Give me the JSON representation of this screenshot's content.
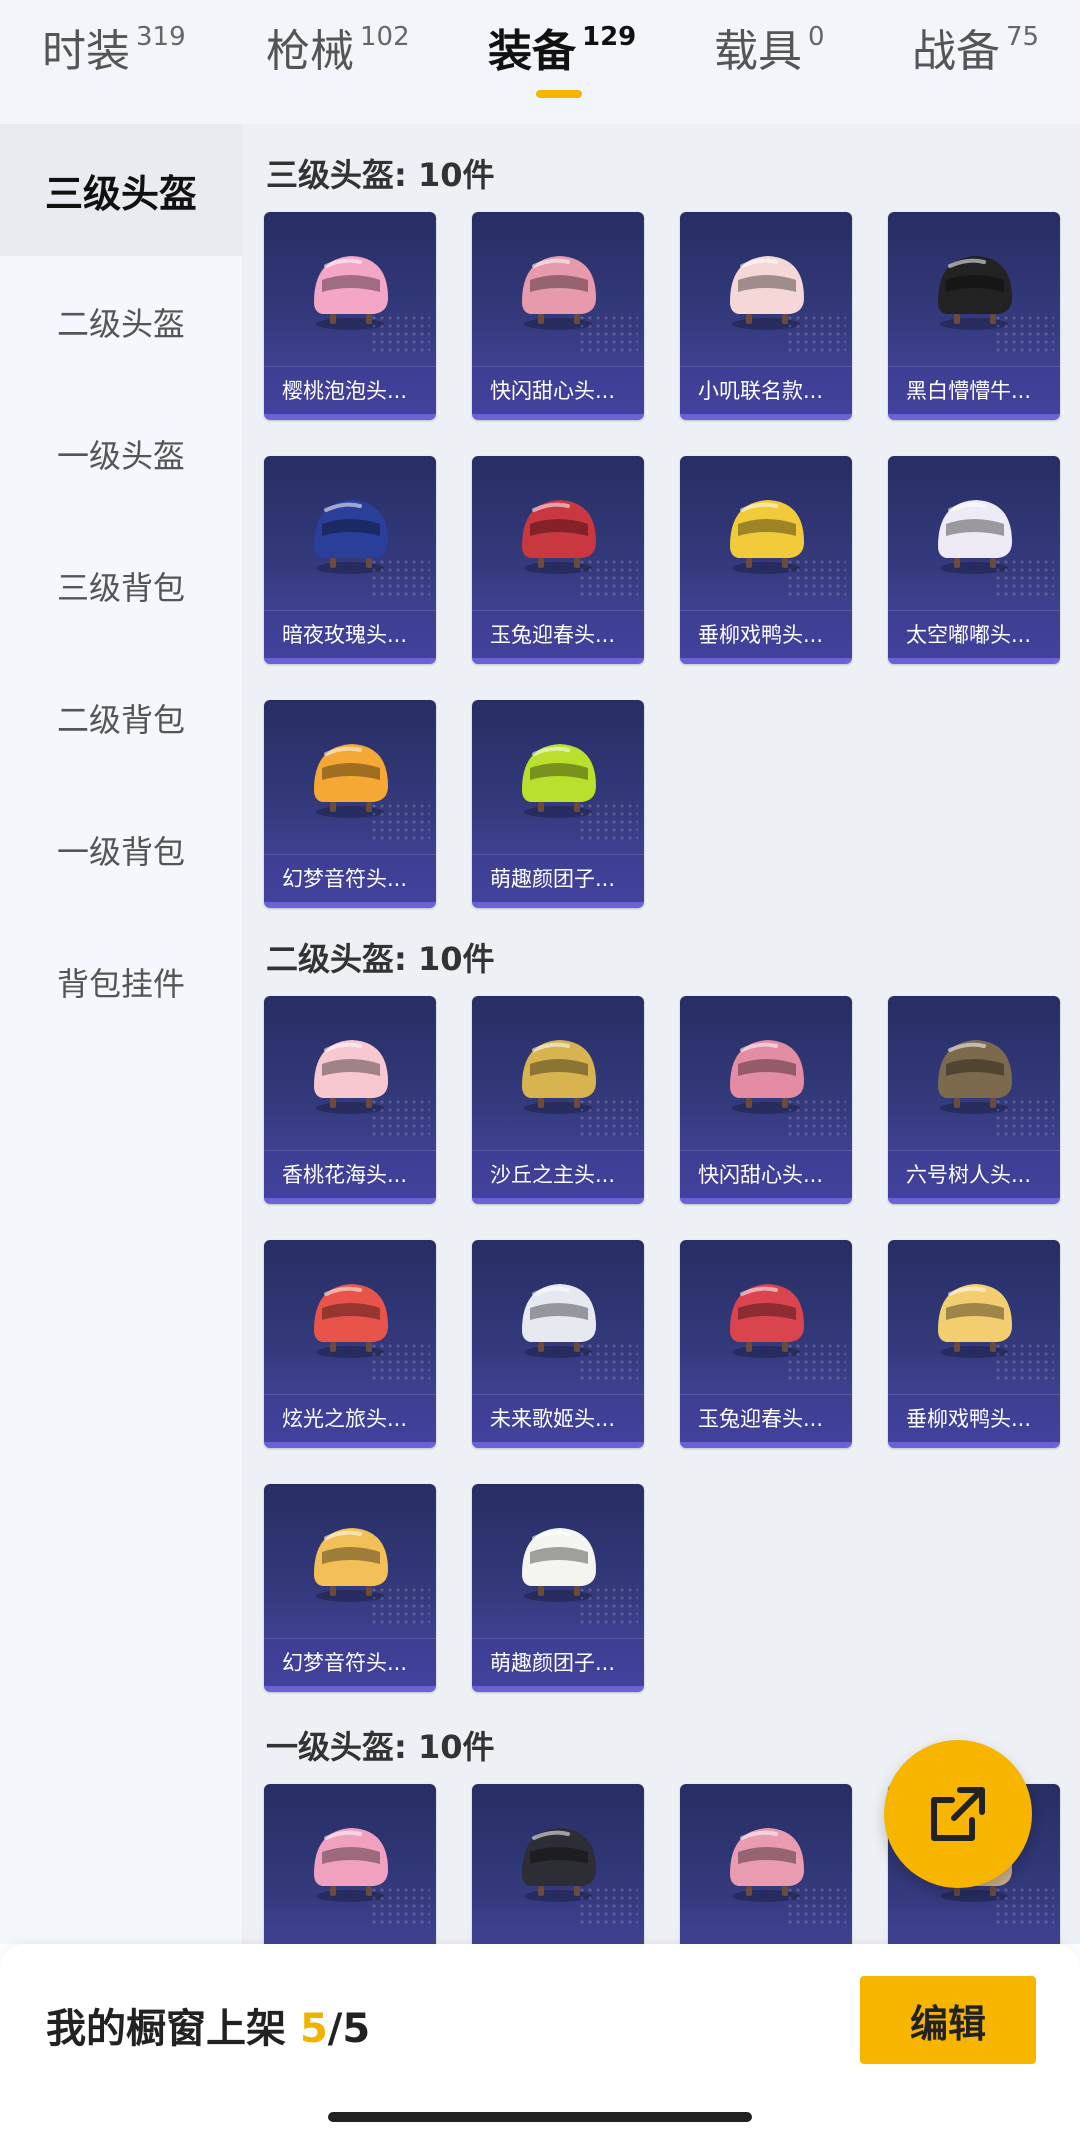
{
  "tabs": [
    {
      "label": "时装",
      "count": "319",
      "active": false
    },
    {
      "label": "枪械",
      "count": "102",
      "active": false
    },
    {
      "label": "装备",
      "count": "129",
      "active": true
    },
    {
      "label": "载具",
      "count": "0",
      "active": false
    },
    {
      "label": "战备",
      "count": "75",
      "active": false
    }
  ],
  "sidebar": {
    "items": [
      {
        "label": "三级头盔",
        "active": true
      },
      {
        "label": "二级头盔",
        "active": false
      },
      {
        "label": "一级头盔",
        "active": false
      },
      {
        "label": "三级背包",
        "active": false
      },
      {
        "label": "二级背包",
        "active": false
      },
      {
        "label": "一级背包",
        "active": false
      },
      {
        "label": "背包挂件",
        "active": false
      }
    ]
  },
  "sections": [
    {
      "title": "三级头盔: 10件",
      "items": [
        {
          "name": "樱桃泡泡头...",
          "icon": "pink-bunny-helmet",
          "color": "#f4a6c6"
        },
        {
          "name": "快闪甜心头...",
          "icon": "pink-visor-helmet",
          "color": "#e79aac"
        },
        {
          "name": "小叽联名款...",
          "icon": "white-chick-helmet",
          "color": "#f6d7d7"
        },
        {
          "name": "黑白懵懵牛...",
          "icon": "cow-helmet",
          "color": "#222222"
        },
        {
          "name": "暗夜玫瑰头...",
          "icon": "dark-rose-helmet",
          "color": "#2a3f9a"
        },
        {
          "name": "玉兔迎春头...",
          "icon": "rabbit-red-helmet",
          "color": "#c9373f"
        },
        {
          "name": "垂柳戏鸭头...",
          "icon": "duck-helmet",
          "color": "#f2cb3b"
        },
        {
          "name": "太空嘟嘟头...",
          "icon": "space-bunny-helmet",
          "color": "#eeeaf6"
        },
        {
          "name": "幻梦音符头...",
          "icon": "dream-note-helmet",
          "color": "#f5a934"
        },
        {
          "name": "萌趣颜团子...",
          "icon": "green-sprout-helmet",
          "color": "#b8e02c"
        }
      ]
    },
    {
      "title": "二级头盔: 10件",
      "items": [
        {
          "name": "香桃花海头...",
          "icon": "peach-helmet",
          "color": "#f7c8cf"
        },
        {
          "name": "沙丘之主头...",
          "icon": "dune-helmet",
          "color": "#d8b451"
        },
        {
          "name": "快闪甜心头...",
          "icon": "pink-sweet-helmet",
          "color": "#e38ca4"
        },
        {
          "name": "六号树人头...",
          "icon": "tree-helmet",
          "color": "#7b6b4c"
        },
        {
          "name": "炫光之旅头...",
          "icon": "red-cross-helmet",
          "color": "#e8544a"
        },
        {
          "name": "未来歌姬头...",
          "icon": "white-diva-helmet",
          "color": "#e6e9f0"
        },
        {
          "name": "玉兔迎春头...",
          "icon": "rabbit-white-red-helmet",
          "color": "#d9444d"
        },
        {
          "name": "垂柳戏鸭头...",
          "icon": "yellow-duck-helmet",
          "color": "#f3ce70"
        },
        {
          "name": "幻梦音符头...",
          "icon": "dream-note-lv2-helmet",
          "color": "#f3c057"
        },
        {
          "name": "萌趣颜团子...",
          "icon": "sprout-white-helmet",
          "color": "#f5f5f0"
        }
      ]
    },
    {
      "title": "一级头盔: 10件",
      "items": [
        {
          "name": "",
          "icon": "pink-heart-helmet",
          "color": "#f1a1c0"
        },
        {
          "name": "",
          "icon": "dark-gas-helmet",
          "color": "#2d2d35"
        },
        {
          "name": "",
          "icon": "pink-moto-helmet",
          "color": "#e99bb0"
        },
        {
          "name": "",
          "icon": "tan-helmet",
          "color": "#c9b089"
        }
      ]
    }
  ],
  "fab": {
    "icon": "share-external-icon"
  },
  "bottom": {
    "label": "我的橱窗上架",
    "current": "5",
    "total": "/5",
    "edit_label": "编辑"
  },
  "colors": {
    "accent": "#f7b500",
    "card_bg_top": "#262e63",
    "card_bg_bottom": "#4b49a6"
  }
}
